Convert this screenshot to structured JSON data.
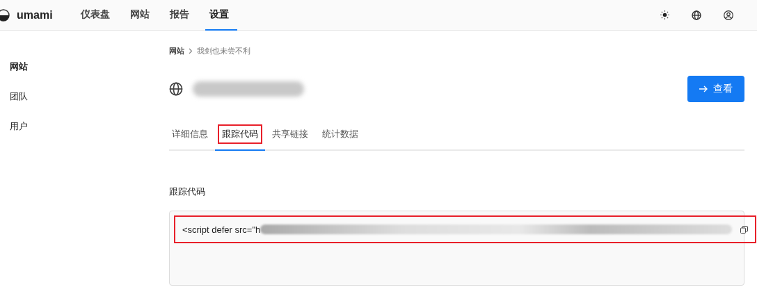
{
  "header": {
    "brand": "umami",
    "nav": [
      {
        "label": "仪表盘",
        "selected": false
      },
      {
        "label": "网站",
        "selected": false
      },
      {
        "label": "报告",
        "selected": false
      },
      {
        "label": "设置",
        "selected": true
      }
    ]
  },
  "sidebar": {
    "items": [
      {
        "label": "网站",
        "selected": true
      },
      {
        "label": "团队",
        "selected": false
      },
      {
        "label": "用户",
        "selected": false
      }
    ]
  },
  "breadcrumb": [
    "网站",
    "我剑也未尝不利"
  ],
  "site": {
    "button": "查看"
  },
  "tabs": [
    {
      "label": "详细信息",
      "selected": false,
      "highlighted": false
    },
    {
      "label": "跟踪代码",
      "selected": true,
      "highlighted": true
    },
    {
      "label": "共享链接",
      "selected": false,
      "highlighted": false
    },
    {
      "label": "统计数据",
      "selected": false,
      "highlighted": false
    }
  ],
  "code_section": {
    "title": "跟踪代码",
    "code": "<script defer src=\"h",
    "highlighted": true
  }
}
